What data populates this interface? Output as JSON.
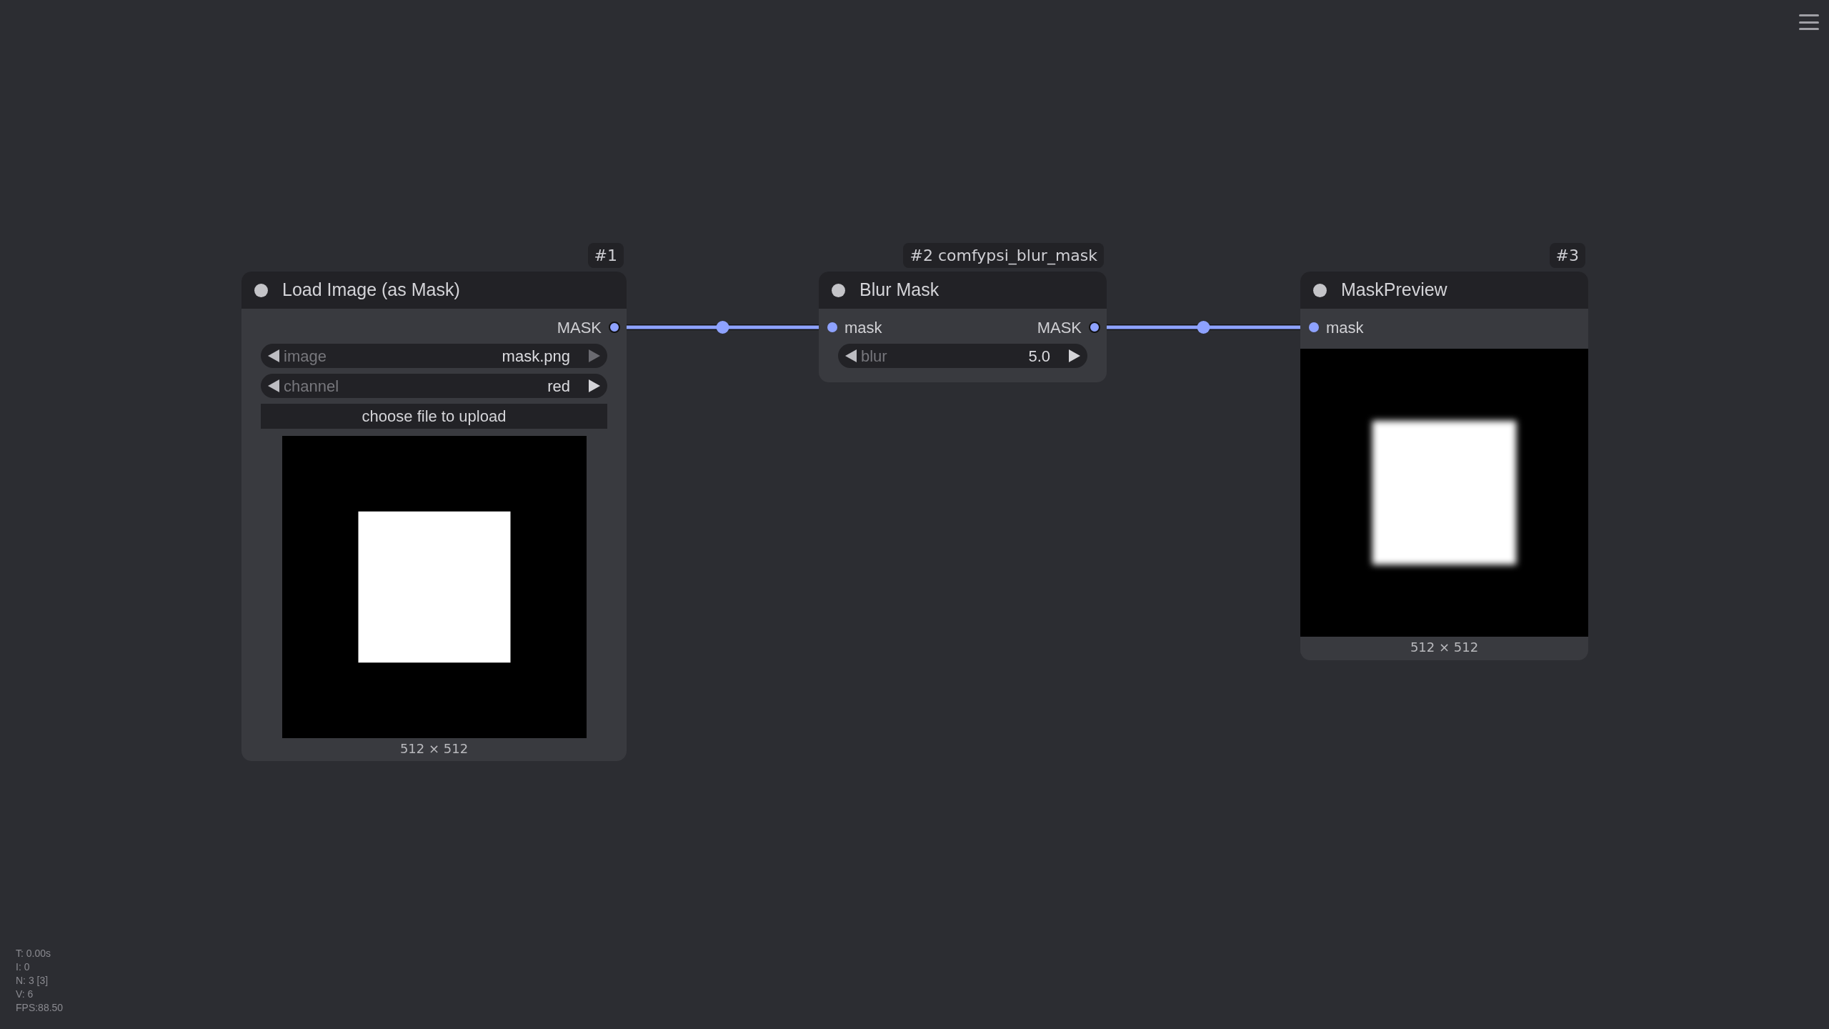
{
  "nodes": [
    {
      "badge": "#1",
      "title": "Load Image (as Mask)",
      "outputs": [
        "MASK"
      ],
      "widgets": [
        {
          "kind": "combo",
          "label": "image",
          "value": "mask.png",
          "next_enabled": false
        },
        {
          "kind": "combo",
          "label": "channel",
          "value": "red",
          "next_enabled": true
        },
        {
          "kind": "button",
          "label": "choose file to upload"
        }
      ],
      "preview": {
        "blurred": false,
        "size": "512 × 512"
      }
    },
    {
      "badge": "#2 comfypsi_blur_mask",
      "title": "Blur Mask",
      "inputs": [
        "mask"
      ],
      "outputs": [
        "MASK"
      ],
      "widgets": [
        {
          "kind": "number",
          "label": "blur",
          "value": "5.0",
          "next_enabled": true
        }
      ]
    },
    {
      "badge": "#3",
      "title": "MaskPreview",
      "inputs": [
        "mask"
      ],
      "preview": {
        "blurred": true,
        "size": "512 × 512"
      }
    }
  ],
  "stats": [
    "T: 0.00s",
    "I: 0",
    "N: 3 [3]",
    "V: 6",
    "FPS:88.50"
  ]
}
